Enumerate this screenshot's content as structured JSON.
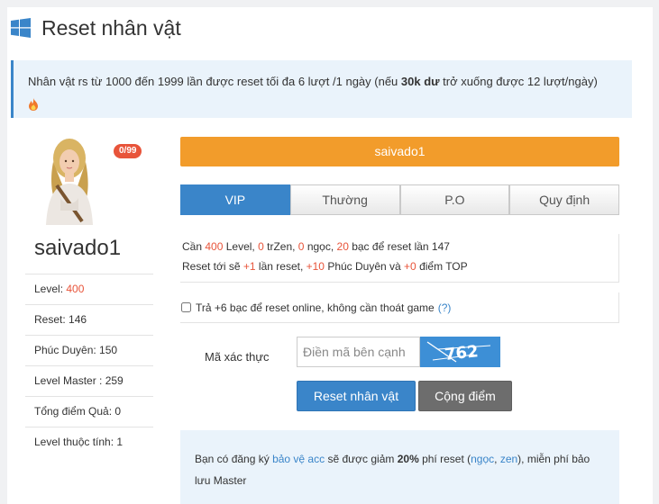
{
  "header": {
    "title": "Reset nhân vật",
    "icon": "windows-icon"
  },
  "notice": {
    "text_before": "Nhân vật rs từ 1000 đến 1999 lần được reset tối đa 6 lượt /1 ngày (nếu ",
    "bold": "30k dư",
    "text_after": " trở xuống được 12 lượt/ngày)",
    "icon": "flame-icon"
  },
  "character": {
    "name": "saivado1",
    "badge": "0/99",
    "stats": [
      {
        "label": "Level: ",
        "value": "400",
        "highlight": true
      },
      {
        "label": "Reset: ",
        "value": "146",
        "highlight": false
      },
      {
        "label": "Phúc Duyên: ",
        "value": "150",
        "highlight": false
      },
      {
        "label": "Level Master : ",
        "value": "259",
        "highlight": false
      },
      {
        "label": "Tổng điểm Quả: ",
        "value": "0",
        "highlight": false
      },
      {
        "label": "Level thuộc tính: ",
        "value": "1",
        "highlight": false
      }
    ]
  },
  "name_bar": "saivado1",
  "tabs": [
    "VIP",
    "Thường",
    "P.O",
    "Quy định"
  ],
  "active_tab": "VIP",
  "requirements": {
    "line1": {
      "p1": "Cần ",
      "level": "400",
      "p2": " Level, ",
      "zen": "0",
      "p3": " trZen, ",
      "ngoc": "0",
      "p4": " ngọc, ",
      "bac": "20",
      "p5": " bạc để reset lần 147"
    },
    "line2": {
      "p1": "Reset tới sẽ ",
      "a": "+1",
      "p2": " lần reset, ",
      "b": "+10",
      "p3": " Phúc Duyên và ",
      "c": "+0",
      "p4": " điểm TOP"
    }
  },
  "online_reset": {
    "label": "Trả +6 bạc để reset online, không cần thoát game",
    "help": "(?)",
    "checked": false
  },
  "captcha": {
    "label": "Mã xác thực",
    "placeholder": "Điền mã bên cạnh",
    "code": "762"
  },
  "buttons": {
    "reset": "Reset nhân vật",
    "add_points": "Cộng điểm"
  },
  "footer": {
    "p1": "Bạn có đăng ký ",
    "link": "bảo vệ acc",
    "p2": " sẽ được giảm ",
    "bold": "20%",
    "p3": " phí reset (",
    "ngoc": "ngọc",
    "comma": ", ",
    "zen": "zen",
    "p4": "), miễn phí bảo lưu Master"
  },
  "colors": {
    "accent": "#3a85c9",
    "orange": "#f29c2b",
    "red": "#e8543a",
    "gray_button": "#6d6d6d",
    "notice_bg": "#eaf3fb"
  }
}
